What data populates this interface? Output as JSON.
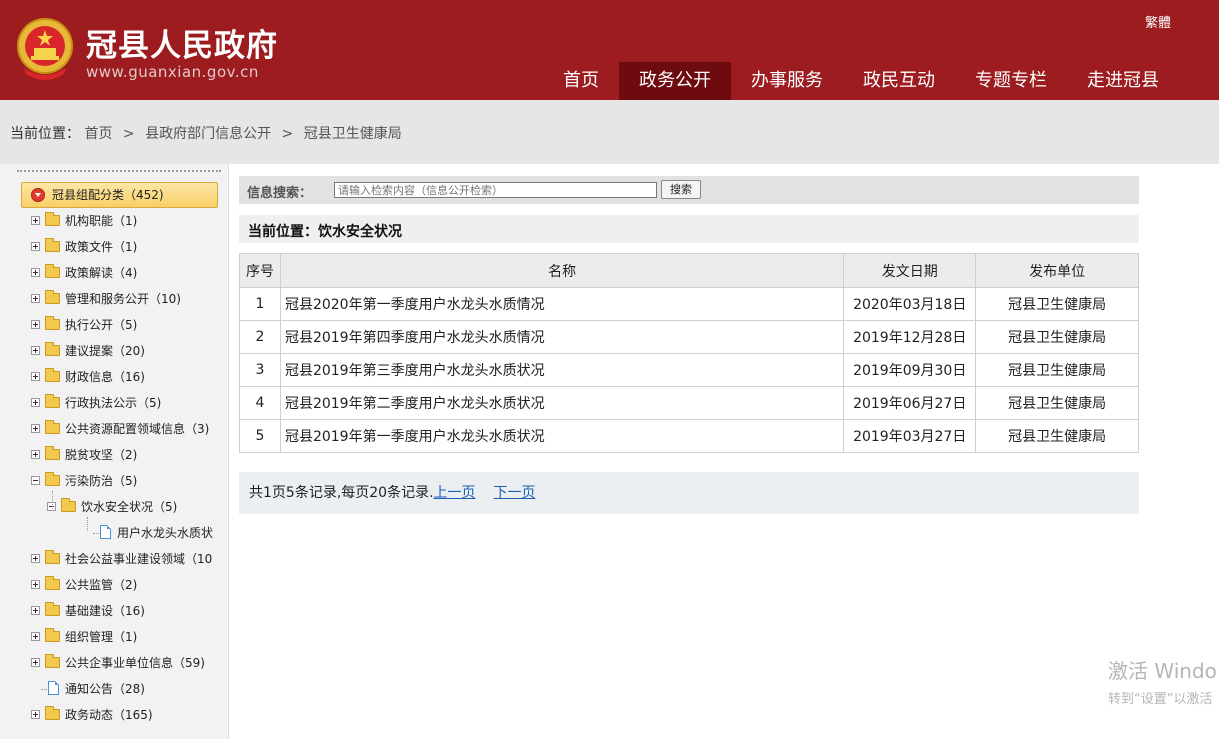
{
  "header": {
    "title": "冠县人民政府",
    "url": "www.guanxian.gov.cn",
    "lang_switch": "繁體",
    "nav": [
      {
        "label": "首页",
        "active": false
      },
      {
        "label": "政务公开",
        "active": true
      },
      {
        "label": "办事服务",
        "active": false
      },
      {
        "label": "政民互动",
        "active": false
      },
      {
        "label": "专题专栏",
        "active": false
      },
      {
        "label": "走进冠县",
        "active": false
      }
    ],
    "colors": {
      "primary": "#9c1c20",
      "active_nav": "#6e0b0e"
    }
  },
  "breadcrumb": {
    "label": "当前位置：",
    "items": [
      "首页",
      "县政府部门信息公开",
      "冠县卫生健康局"
    ],
    "separator": ">"
  },
  "sidebar": {
    "root": "冠县组配分类（452)",
    "items": [
      {
        "label": "机构职能（1)",
        "type": "folder",
        "level": 1,
        "expander": "plus"
      },
      {
        "label": "政策文件（1)",
        "type": "folder",
        "level": 1,
        "expander": "plus"
      },
      {
        "label": "政策解读（4)",
        "type": "folder",
        "level": 1,
        "expander": "plus"
      },
      {
        "label": "管理和服务公开（10)",
        "type": "folder",
        "level": 1,
        "expander": "plus"
      },
      {
        "label": "执行公开（5)",
        "type": "folder",
        "level": 1,
        "expander": "plus"
      },
      {
        "label": "建议提案（20)",
        "type": "folder",
        "level": 1,
        "expander": "plus"
      },
      {
        "label": "财政信息（16)",
        "type": "folder",
        "level": 1,
        "expander": "plus"
      },
      {
        "label": "行政执法公示（5)",
        "type": "folder",
        "level": 1,
        "expander": "plus"
      },
      {
        "label": "公共资源配置领域信息（3)",
        "type": "folder",
        "level": 1,
        "expander": "plus"
      },
      {
        "label": "脱贫攻坚（2)",
        "type": "folder",
        "level": 1,
        "expander": "plus"
      },
      {
        "label": "污染防治（5)",
        "type": "folder",
        "level": 1,
        "expander": "minus"
      },
      {
        "label": "饮水安全状况（5)",
        "type": "folder",
        "level": 2,
        "expander": "minus"
      },
      {
        "label": "用户水龙头水质状",
        "type": "doc",
        "level": 3,
        "expander": "none"
      },
      {
        "label": "社会公益事业建设领域（10",
        "type": "folder",
        "level": 1,
        "expander": "plus"
      },
      {
        "label": "公共监管（2)",
        "type": "folder",
        "level": 1,
        "expander": "plus"
      },
      {
        "label": "基础建设（16)",
        "type": "folder",
        "level": 1,
        "expander": "plus"
      },
      {
        "label": "组织管理（1)",
        "type": "folder",
        "level": 1,
        "expander": "plus"
      },
      {
        "label": "公共企事业单位信息（59)",
        "type": "folder",
        "level": 1,
        "expander": "plus"
      },
      {
        "label": "通知公告（28)",
        "type": "doc",
        "level": 1,
        "expander": "none"
      },
      {
        "label": "政务动态（165)",
        "type": "folder",
        "level": 1,
        "expander": "plus"
      }
    ]
  },
  "search": {
    "label": "信息搜索：",
    "placeholder": "请输入检索内容（信息公开检索）",
    "button": "搜索"
  },
  "section": {
    "title": "当前位置：饮水安全状况"
  },
  "table": {
    "headers": [
      "序号",
      "名称",
      "发文日期",
      "发布单位"
    ],
    "rows": [
      {
        "num": "1",
        "name": "冠县2020年第一季度用户水龙头水质情况",
        "date": "2020年03月18日",
        "unit": "冠县卫生健康局"
      },
      {
        "num": "2",
        "name": "冠县2019年第四季度用户水龙头水质情况",
        "date": "2019年12月28日",
        "unit": "冠县卫生健康局"
      },
      {
        "num": "3",
        "name": "冠县2019年第三季度用户水龙头水质状况",
        "date": "2019年09月30日",
        "unit": "冠县卫生健康局"
      },
      {
        "num": "4",
        "name": "冠县2019年第二季度用户水龙头水质状况",
        "date": "2019年06月27日",
        "unit": "冠县卫生健康局"
      },
      {
        "num": "5",
        "name": "冠县2019年第一季度用户水龙头水质状况",
        "date": "2019年03月27日",
        "unit": "冠县卫生健康局"
      }
    ]
  },
  "pager": {
    "summary": "共1页5条记录,每页20条记录.",
    "prev": "上一页",
    "next": "下一页"
  },
  "watermark": {
    "line1": "激活 Windo",
    "line2": "转到“设置”以激活"
  }
}
